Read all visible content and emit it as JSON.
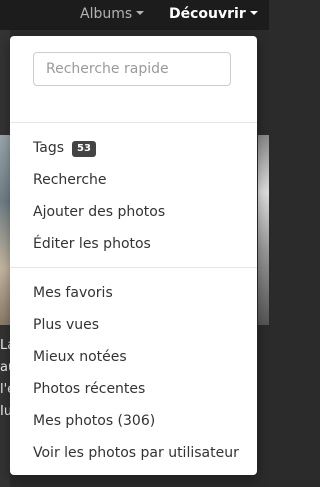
{
  "navbar": {
    "albums_label": "Albums",
    "decouvrir_label": "Découvrir"
  },
  "background": {
    "text_lines": [
      "La",
      "au",
      "l'e",
      "Iu"
    ]
  },
  "dropdown": {
    "search": {
      "placeholder": "Recherche rapide",
      "value": ""
    },
    "group1": [
      {
        "label": "Tags",
        "badge": "53"
      },
      {
        "label": "Recherche"
      },
      {
        "label": "Ajouter des photos"
      },
      {
        "label": "Éditer les photos"
      }
    ],
    "group2": [
      {
        "label": "Mes favoris"
      },
      {
        "label": "Plus vues"
      },
      {
        "label": "Mieux notées"
      },
      {
        "label": "Photos récentes"
      },
      {
        "label": "Mes photos (306)"
      },
      {
        "label": "Voir les photos par utilisateur"
      }
    ]
  }
}
